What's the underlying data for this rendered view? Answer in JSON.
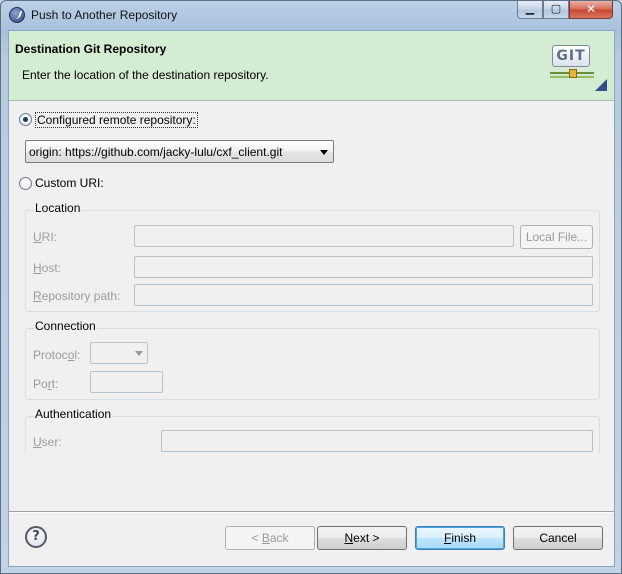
{
  "window": {
    "title": "Push to Another Repository",
    "minimize_glyph": "▁",
    "maximize_glyph": "▢",
    "close_glyph": "✕"
  },
  "banner": {
    "title": "Destination Git Repository",
    "description": "Enter the location of the destination repository.",
    "logo_text": "GIT"
  },
  "remote": {
    "configured_label": "Configured remote repository:",
    "configured_selected": true,
    "selected_remote": "origin: https://github.com/jacky-lulu/cxf_client.git",
    "custom_label": "Custom URI:",
    "custom_selected": false
  },
  "location": {
    "group_title": "Location",
    "uri_label": "URI:",
    "uri_value": "",
    "local_file_button": "Local File...",
    "host_label": "Host:",
    "host_value": "",
    "repo_path_label": "Repository path:",
    "repo_path_value": ""
  },
  "connection": {
    "group_title": "Connection",
    "protocol_label": "Protocol:",
    "protocol_value": "",
    "port_label": "Port:",
    "port_value": ""
  },
  "authentication": {
    "group_title": "Authentication",
    "user_label": "User:",
    "user_value": ""
  },
  "footer": {
    "help_glyph": "?",
    "back_prefix": "< ",
    "back_mnemonic": "B",
    "back_rest": "ack",
    "next_mnemonic": "N",
    "next_rest": "ext >",
    "finish_mnemonic": "F",
    "finish_rest": "inish",
    "cancel_label": "Cancel"
  }
}
